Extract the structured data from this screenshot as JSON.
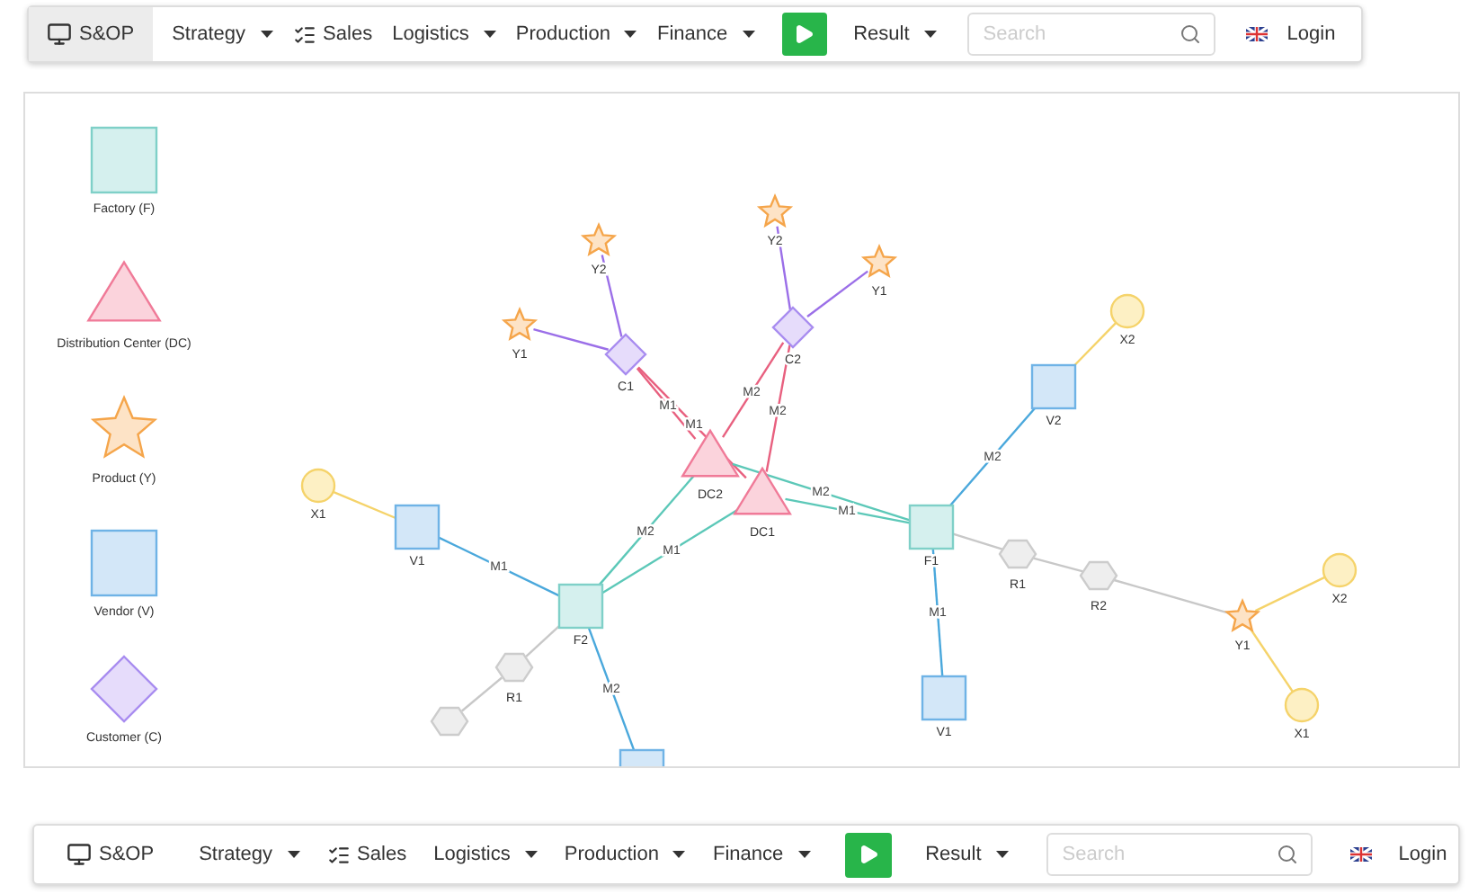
{
  "top_navbar": {
    "items": [
      {
        "kind": "brand",
        "label": "S&OP",
        "selected": true
      },
      {
        "kind": "dropdown",
        "label": "Strategy"
      },
      {
        "kind": "iconlink",
        "label": "Sales"
      },
      {
        "kind": "dropdown",
        "label": "Logistics"
      },
      {
        "kind": "dropdown",
        "label": "Production"
      },
      {
        "kind": "dropdown",
        "label": "Finance"
      },
      {
        "kind": "play"
      },
      {
        "kind": "dropdown",
        "label": "Result"
      },
      {
        "kind": "search",
        "placeholder": "Search"
      },
      {
        "kind": "flag"
      },
      {
        "kind": "link",
        "label": "Login"
      }
    ]
  },
  "diagram": {
    "legend": [
      {
        "kind": "factory",
        "label": "Factory (F)"
      },
      {
        "kind": "distribution",
        "label": "Distribution Center (DC)"
      },
      {
        "kind": "product",
        "label": "Product (Y)"
      },
      {
        "kind": "vendor",
        "label": "Vendor (V)"
      },
      {
        "kind": "customer",
        "label": "Customer (C)"
      }
    ],
    "nodes": [
      {
        "kind": "input",
        "label": "X1"
      },
      {
        "kind": "vendor",
        "label": "V1"
      },
      {
        "kind": "factory",
        "label": "F2"
      },
      {
        "kind": "resource",
        "label": "R1"
      },
      {
        "kind": "resource"
      },
      {
        "kind": "distribution",
        "label": "DC2"
      },
      {
        "kind": "distribution",
        "label": "DC1"
      },
      {
        "kind": "customer",
        "label": "C1"
      },
      {
        "kind": "customer",
        "label": "C2"
      },
      {
        "kind": "product",
        "label": "Y2"
      },
      {
        "kind": "product",
        "label": "Y1"
      },
      {
        "kind": "product",
        "label": "Y2"
      },
      {
        "kind": "product",
        "label": "Y1"
      },
      {
        "kind": "factory",
        "label": "F1"
      },
      {
        "kind": "vendor",
        "label": "V2"
      },
      {
        "kind": "input",
        "label": "X2"
      },
      {
        "kind": "resource",
        "label": "R1"
      },
      {
        "kind": "resource",
        "label": "R2"
      },
      {
        "kind": "product",
        "label": "Y1"
      },
      {
        "kind": "input",
        "label": "X2"
      },
      {
        "kind": "input",
        "label": "X1"
      },
      {
        "kind": "vendor",
        "label": "V1"
      },
      {
        "kind": "vendor"
      }
    ],
    "edges": [
      {
        "color": "#f5d36a"
      },
      {
        "label": "M1",
        "color": "#4aa8dc"
      },
      {
        "label": "M2",
        "color": "#5cc8b8"
      },
      {
        "label": "M1",
        "color": "#5cc8b8"
      },
      {
        "color": "#c8c8c8"
      },
      {
        "color": "#c8c8c8"
      },
      {
        "label": "M2",
        "color": "#4aa8dc"
      },
      {
        "label": "M1",
        "color": "#e8607f"
      },
      {
        "label": "M1",
        "color": "#e8607f"
      },
      {
        "label": "M2",
        "color": "#e8607f"
      },
      {
        "label": "M2",
        "color": "#e8607f"
      },
      {
        "color": "#9b6fe8"
      },
      {
        "color": "#9b6fe8"
      },
      {
        "color": "#9b6fe8"
      },
      {
        "color": "#9b6fe8"
      },
      {
        "label": "M2",
        "color": "#5cc8b8"
      },
      {
        "label": "M1",
        "color": "#5cc8b8"
      },
      {
        "label": "M2",
        "color": "#4aa8dc"
      },
      {
        "color": "#f5d36a"
      },
      {
        "label": "M1",
        "color": "#4aa8dc"
      },
      {
        "color": "#c8c8c8"
      },
      {
        "color": "#c8c8c8"
      },
      {
        "color": "#c8c8c8"
      },
      {
        "color": "#f5d36a"
      },
      {
        "color": "#f5d36a"
      }
    ]
  },
  "bottom_navbar": {
    "items": [
      {
        "kind": "brand",
        "label": "S&OP",
        "selected": false
      },
      {
        "kind": "dropdown",
        "label": "Strategy"
      },
      {
        "kind": "iconlink",
        "label": "Sales"
      },
      {
        "kind": "dropdown",
        "label": "Logistics"
      },
      {
        "kind": "dropdown",
        "label": "Production"
      },
      {
        "kind": "dropdown",
        "label": "Finance"
      },
      {
        "kind": "play"
      },
      {
        "kind": "dropdown",
        "label": "Result"
      },
      {
        "kind": "search",
        "placeholder": "Search"
      },
      {
        "kind": "flag"
      },
      {
        "kind": "link",
        "label": "Login"
      }
    ]
  }
}
